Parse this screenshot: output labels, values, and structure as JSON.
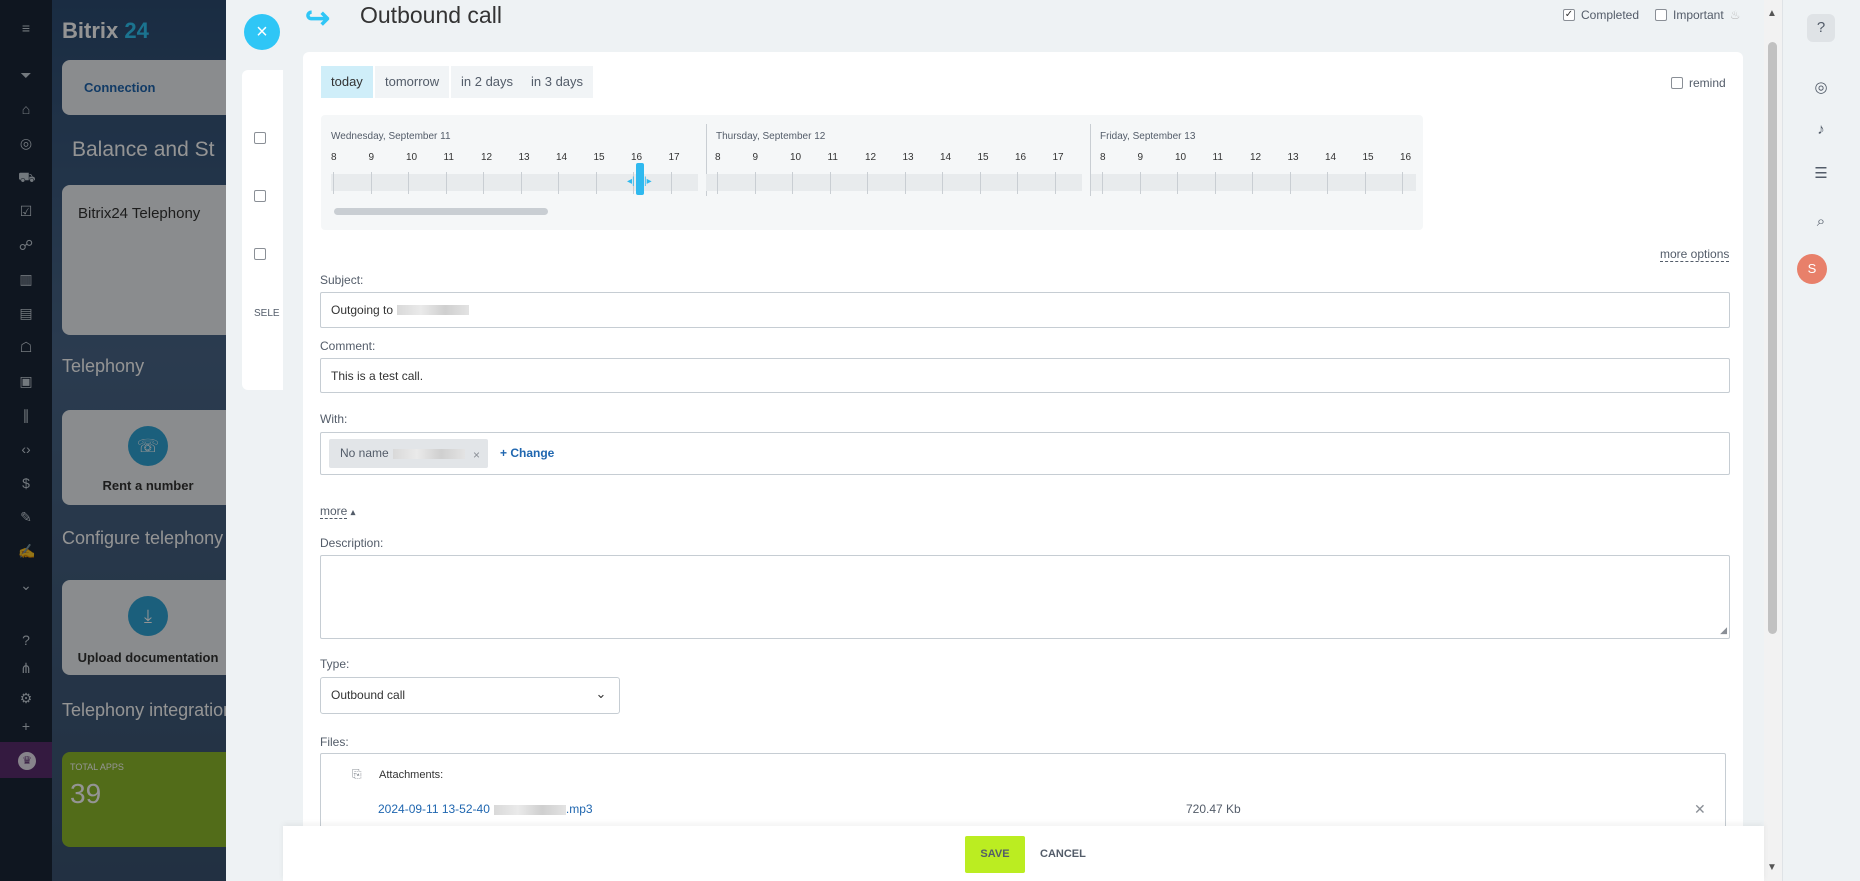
{
  "app": {
    "logo_text": "Bitrix",
    "logo_num": "24"
  },
  "background": {
    "tab_connection": "Connection",
    "heading_balance": "Balance and St",
    "card_telephony": "Bitrix24 Telephony",
    "heading_telephony": "Telephony",
    "rent_label": "Rent a number",
    "heading_configure": "Configure telephony",
    "upload_label": "Upload documentation",
    "heading_integration": "Telephony integration",
    "total_apps_label": "TOTAL APPS",
    "total_apps_value": "39",
    "select_label": "SELE"
  },
  "header": {
    "title": "Outbound call",
    "completed_label": "Completed",
    "completed_checked": true,
    "important_label": "Important",
    "important_checked": false
  },
  "date_tabs": [
    "today",
    "tomorrow",
    "in 2 days",
    "in 3 days"
  ],
  "remind_label": "remind",
  "timeline": {
    "days": [
      "Wednesday, September 11",
      "Thursday, September 12",
      "Friday, September 13"
    ],
    "hours_day1": [
      "8",
      "9",
      "10",
      "11",
      "12",
      "13",
      "14",
      "15",
      "16",
      "17"
    ],
    "hours_day2": [
      "8",
      "9",
      "10",
      "11",
      "12",
      "13",
      "14",
      "15",
      "16",
      "17"
    ],
    "hours_day3": [
      "8",
      "9",
      "10",
      "11",
      "12",
      "13",
      "14",
      "15",
      "16"
    ]
  },
  "more_options": "more options",
  "subject": {
    "label": "Subject:",
    "value": "Outgoing to"
  },
  "comment": {
    "label": "Comment:",
    "value": "This is a test call."
  },
  "with": {
    "label": "With:",
    "chip": "No name",
    "change": "+ Change"
  },
  "more_toggle": "more",
  "description": {
    "label": "Description:"
  },
  "type": {
    "label": "Type:",
    "value": "Outbound call"
  },
  "files": {
    "label": "Files:",
    "attachments_label": "Attachments:",
    "file_name_start": "2024-09-11 13-52-40",
    "file_name_end": ".mp3",
    "file_size": "720.47 Kb"
  },
  "footer": {
    "save": "SAVE",
    "cancel": "CANCEL"
  },
  "user_initial": "S"
}
